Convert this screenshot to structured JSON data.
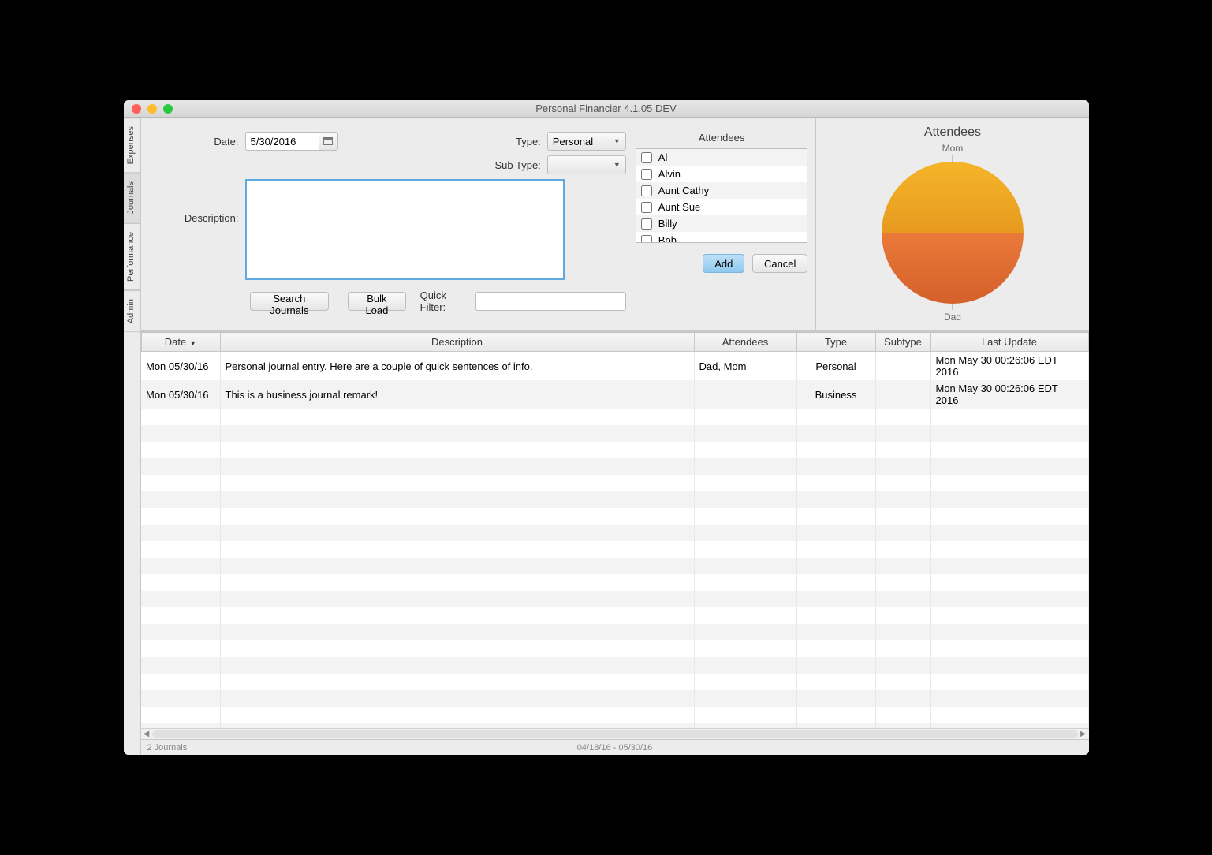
{
  "window": {
    "title": "Personal Financier 4.1.05 DEV"
  },
  "tabs": [
    "Expenses",
    "Journals",
    "Performance",
    "Admin"
  ],
  "form": {
    "date_label": "Date:",
    "date_value": "5/30/2016",
    "type_label": "Type:",
    "type_value": "Personal",
    "subtype_label": "Sub Type:",
    "subtype_value": "",
    "description_label": "Description:",
    "description_value": "",
    "attendees_label": "Attendees",
    "attendees": [
      "Al",
      "Alvin",
      "Aunt Cathy",
      "Aunt Sue",
      "Billy",
      "Bob"
    ],
    "add_label": "Add",
    "cancel_label": "Cancel"
  },
  "toolbar": {
    "search_label": "Search Journals",
    "bulk_label": "Bulk Load",
    "quick_filter_label": "Quick Filter:",
    "quick_filter_value": ""
  },
  "chart": {
    "title": "Attendees",
    "top_label": "Mom",
    "bottom_label": "Dad"
  },
  "chart_data": {
    "type": "pie",
    "title": "Attendees",
    "series": [
      {
        "name": "Mom",
        "value": 50
      },
      {
        "name": "Dad",
        "value": 50
      }
    ]
  },
  "grid": {
    "columns": [
      "Date",
      "Description",
      "Attendees",
      "Type",
      "Subtype",
      "Last Update"
    ],
    "rows": [
      {
        "date": "Mon 05/30/16",
        "desc": "Personal journal entry.  Here are a couple of quick sentences of info.",
        "att": "Dad, Mom",
        "type": "Personal",
        "sub": "",
        "upd": "Mon May 30 00:26:06 EDT 2016"
      },
      {
        "date": "Mon 05/30/16",
        "desc": "This is a business journal remark!",
        "att": "",
        "type": "Business",
        "sub": "",
        "upd": "Mon May 30 00:26:06 EDT 2016"
      }
    ]
  },
  "status": {
    "left": "2 Journals",
    "center": "04/18/16 - 05/30/16"
  }
}
